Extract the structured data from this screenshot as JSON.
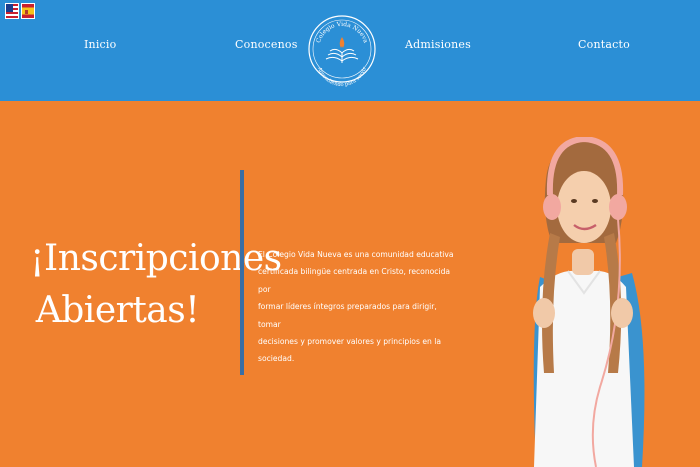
{
  "header": {
    "languages": [
      {
        "name": "English",
        "icon": "us-flag-icon"
      },
      {
        "name": "Español",
        "icon": "spain-flag-icon"
      }
    ],
    "nav": [
      {
        "label": "Inicio"
      },
      {
        "label": "Conocenos"
      },
      {
        "label": "Admisiones"
      },
      {
        "label": "Contacto"
      }
    ],
    "logo": {
      "top_text": "Colegio Vida Nueva",
      "bottom_text": "Aprendiendo para servir"
    }
  },
  "hero": {
    "title_line1": "¡Inscripciones",
    "title_line2": "Abiertas!",
    "description_lines": [
      "El Colegio Vida Nueva es una comunidad educativa",
      "certificada bilingüe centrada en Cristo, reconocida por",
      "formar líderes íntegros preparados para dirigir, tomar",
      "decisiones y promover valores y principios en la sociedad."
    ]
  },
  "colors": {
    "nav_bg": "#2b8fd6",
    "hero_bg": "#f0812f",
    "divider": "#3a6ea5",
    "text": "#ffffff"
  }
}
